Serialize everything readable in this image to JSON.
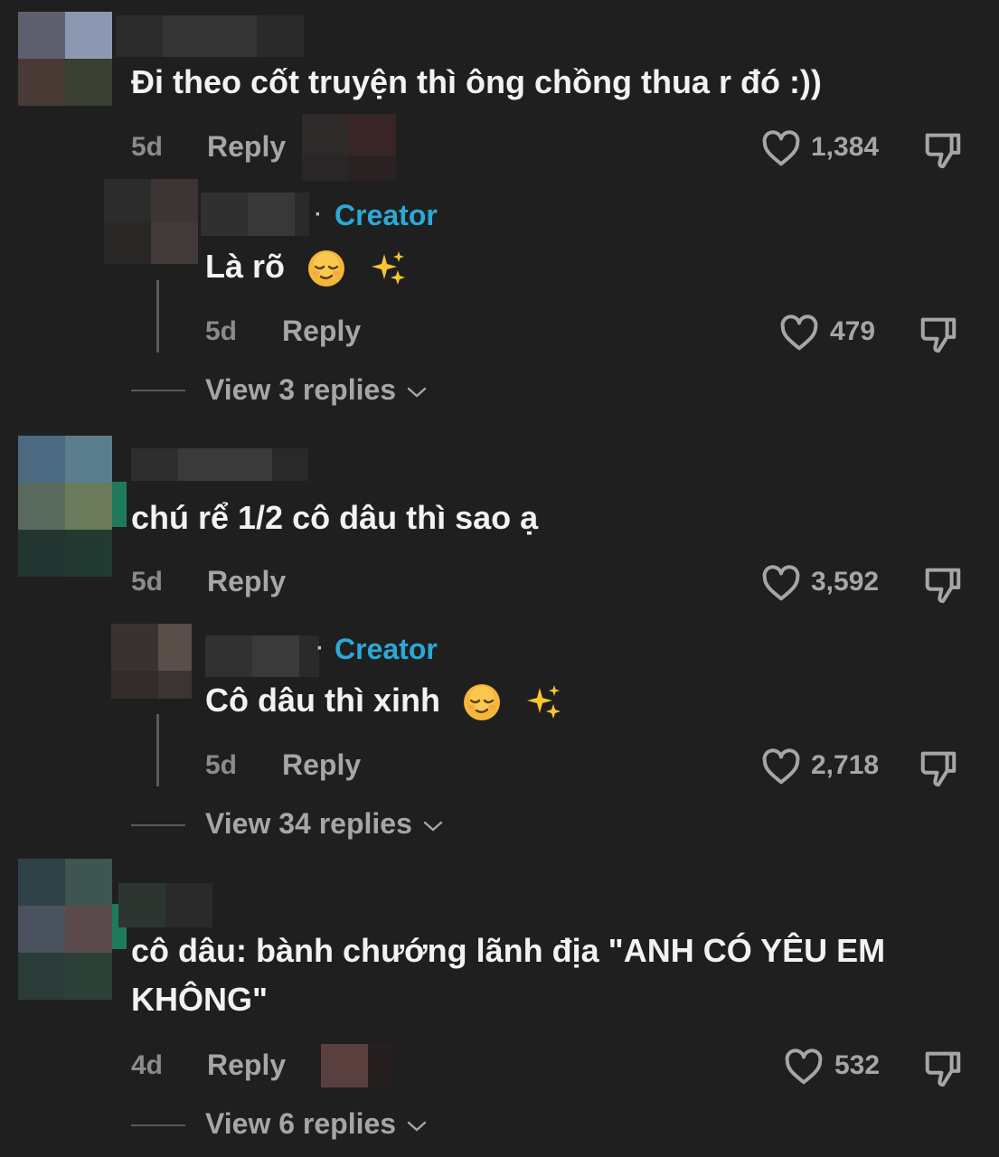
{
  "comments": [
    {
      "text": "Đi theo cốt truyện thì ông chồng thua r đó :))",
      "age": "5d",
      "reply_label": "Reply",
      "likes": "1,384"
    },
    {
      "text": "chú rể 1/2 cô dâu thì sao ạ",
      "age": "5d",
      "reply_label": "Reply",
      "likes": "3,592"
    },
    {
      "text_line1": "cô dâu: bành chướng lãnh địa \"ANH CÓ YÊU EM",
      "text_line2": "KHÔNG\"",
      "age": "4d",
      "reply_label": "Reply",
      "likes": "532"
    }
  ],
  "replies": [
    {
      "badge": "Creator",
      "text": "Là rõ",
      "age": "5d",
      "reply_label": "Reply",
      "likes": "479"
    },
    {
      "badge": "Creator",
      "text": "Cô dâu thì xinh",
      "age": "5d",
      "reply_label": "Reply",
      "likes": "2,718"
    }
  ],
  "view_replies": [
    "View 3 replies",
    "View 34 replies",
    "View 6 replies"
  ],
  "icons": {
    "like": "heart-outline-icon",
    "dislike": "thumbs-down-outline-icon",
    "expand": "chevron-down-icon",
    "emoji_1": "relieved-face-emoji",
    "emoji_2": "sparkles-emoji"
  },
  "colors": {
    "background": "#1f1f1f",
    "creator_badge": "#2aa9d6",
    "muted_text": "#a6a6a6"
  }
}
